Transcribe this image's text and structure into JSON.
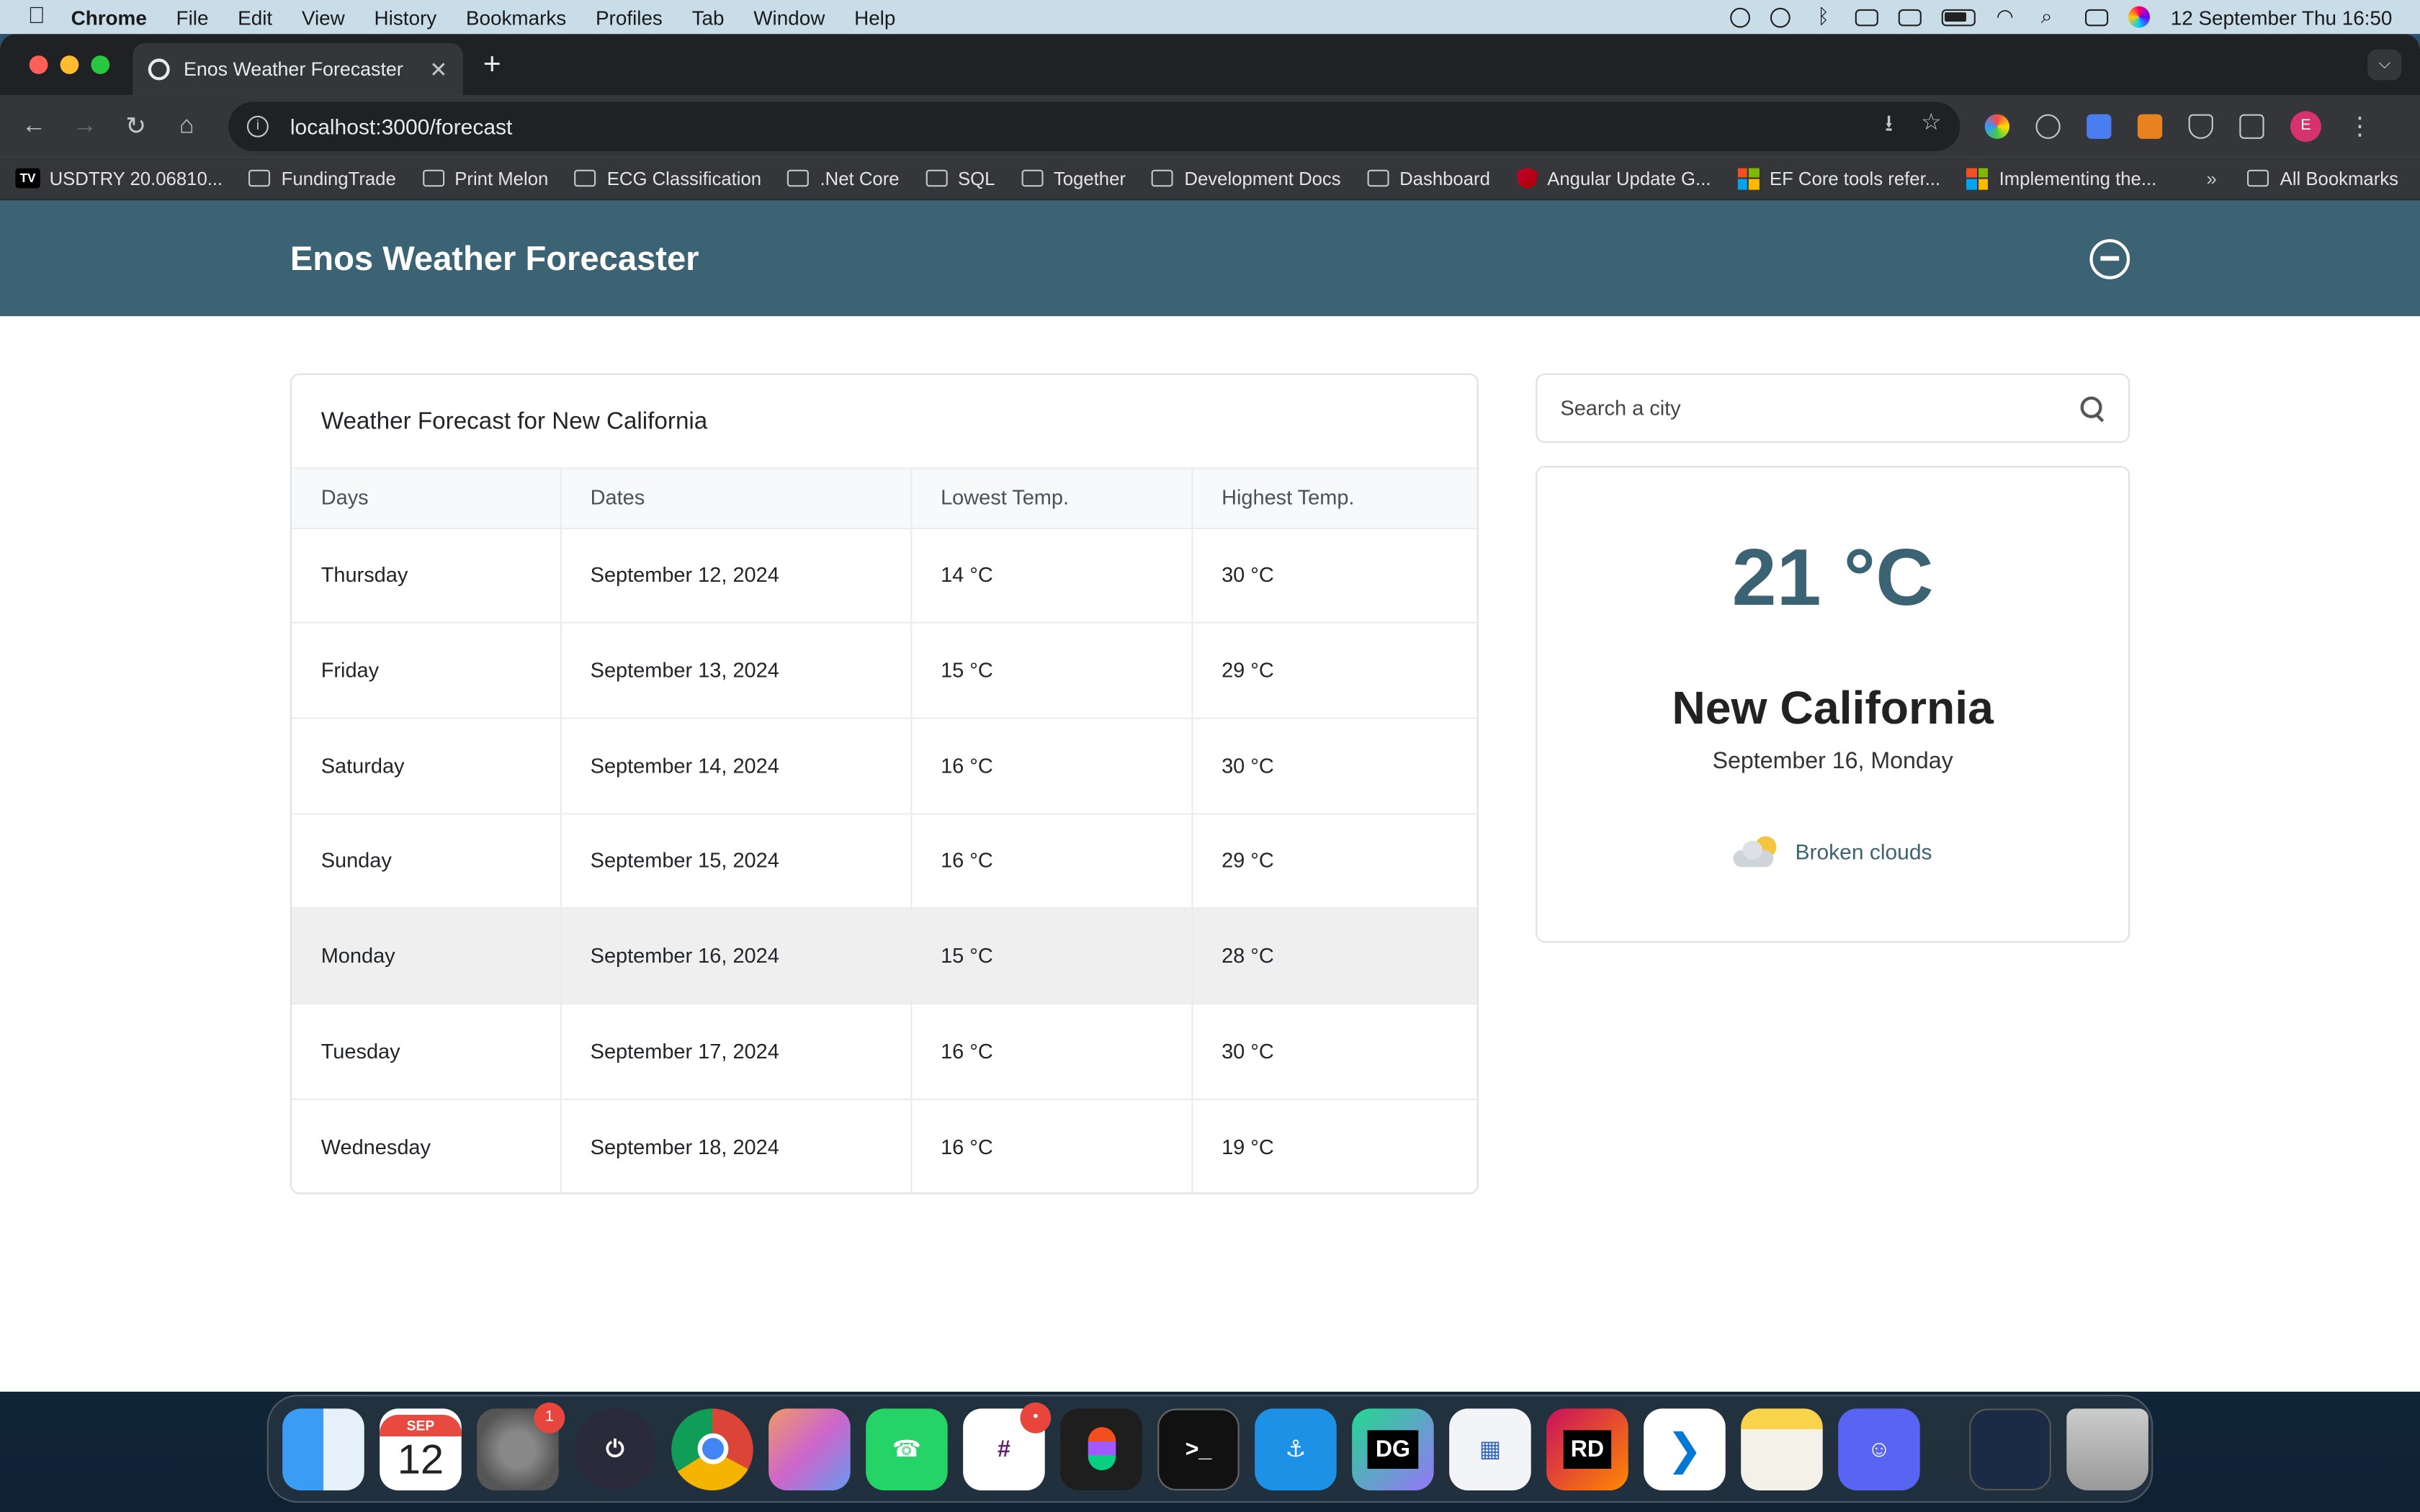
{
  "menubar": {
    "app": "Chrome",
    "items": [
      "File",
      "Edit",
      "View",
      "History",
      "Bookmarks",
      "Profiles",
      "Tab",
      "Window",
      "Help"
    ],
    "clock": "12 September Thu  16:50"
  },
  "browser": {
    "tab_title": "Enos Weather Forecaster",
    "url": "localhost:3000/forecast",
    "bookmarks": [
      {
        "label": "USDTRY 20.06810...",
        "icon": "tradingview-icon"
      },
      {
        "label": "FundingTrade",
        "icon": "folder-icon"
      },
      {
        "label": "Print Melon",
        "icon": "folder-icon"
      },
      {
        "label": "ECG Classification",
        "icon": "folder-icon"
      },
      {
        "label": ".Net Core",
        "icon": "folder-icon"
      },
      {
        "label": "SQL",
        "icon": "folder-icon"
      },
      {
        "label": "Together",
        "icon": "folder-icon"
      },
      {
        "label": "Development Docs",
        "icon": "folder-icon"
      },
      {
        "label": "Dashboard",
        "icon": "folder-icon"
      },
      {
        "label": "Angular Update G...",
        "icon": "angular-icon"
      },
      {
        "label": "EF Core tools refer...",
        "icon": "microsoft-icon"
      },
      {
        "label": "Implementing the...",
        "icon": "microsoft-icon"
      }
    ],
    "all_bookmarks": "All Bookmarks",
    "profile_initial": "E"
  },
  "app": {
    "title": "Enos Weather Forecaster",
    "header_color": "#3c6374",
    "forecast": {
      "title": "Weather Forecast for New California",
      "columns": [
        "Days",
        "Dates",
        "Lowest Temp.",
        "Highest Temp."
      ],
      "rows": [
        {
          "day": "Thursday",
          "date": "September 12, 2024",
          "low": "14 °C",
          "high": "30 °C"
        },
        {
          "day": "Friday",
          "date": "September 13, 2024",
          "low": "15 °C",
          "high": "29 °C"
        },
        {
          "day": "Saturday",
          "date": "September 14, 2024",
          "low": "16 °C",
          "high": "30 °C"
        },
        {
          "day": "Sunday",
          "date": "September 15, 2024",
          "low": "16 °C",
          "high": "29 °C"
        },
        {
          "day": "Monday",
          "date": "September 16, 2024",
          "low": "15 °C",
          "high": "28 °C"
        },
        {
          "day": "Tuesday",
          "date": "September 17, 2024",
          "low": "16 °C",
          "high": "30 °C"
        },
        {
          "day": "Wednesday",
          "date": "September 18, 2024",
          "low": "16 °C",
          "high": "19 °C"
        }
      ],
      "selected_row": 4
    },
    "search": {
      "placeholder": "Search a city"
    },
    "current": {
      "temp": "21 °C",
      "city": "New California",
      "date": "September 16, Monday",
      "condition": "Broken clouds"
    }
  },
  "dock": {
    "calendar_month": "SEP",
    "calendar_day": "12",
    "settings_badge": "1",
    "slack_badge": "•"
  }
}
